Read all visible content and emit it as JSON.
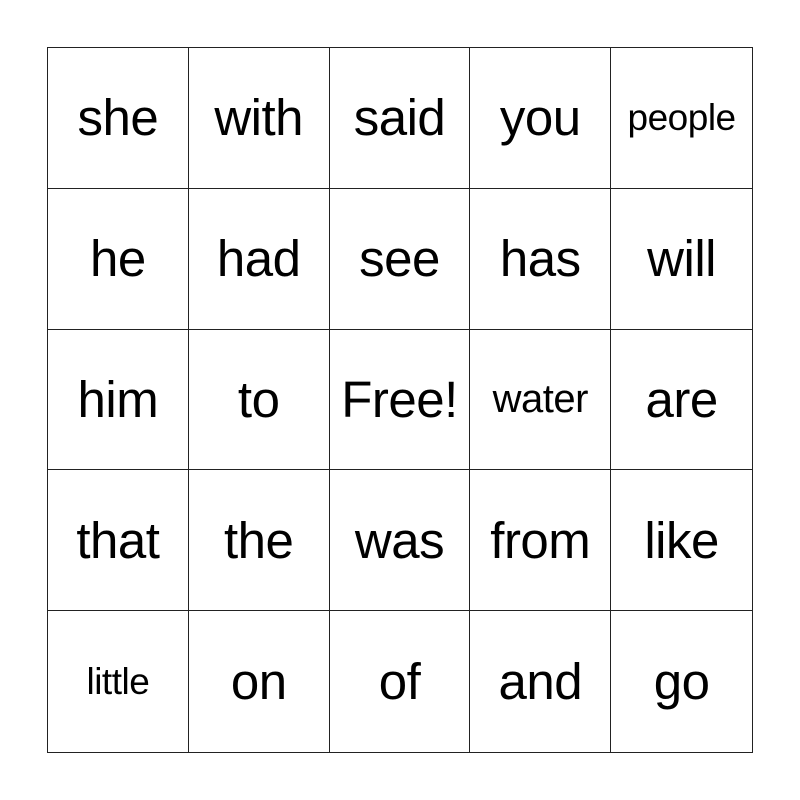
{
  "bingo_card": {
    "rows": [
      [
        "she",
        "with",
        "said",
        "you",
        "people"
      ],
      [
        "he",
        "had",
        "see",
        "has",
        "will"
      ],
      [
        "him",
        "to",
        "Free!",
        "water",
        "are"
      ],
      [
        "that",
        "the",
        "was",
        "from",
        "like"
      ],
      [
        "little",
        "on",
        "of",
        "and",
        "go"
      ]
    ],
    "free_space": "Free!"
  }
}
